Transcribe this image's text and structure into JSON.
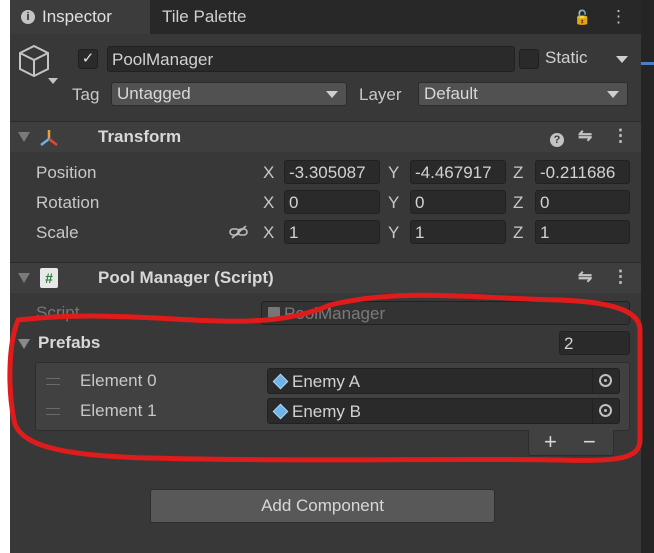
{
  "tabs": [
    {
      "label": "Inspector",
      "icon": "info-icon"
    },
    {
      "label": "Tile Palette"
    }
  ],
  "tab_icons": {
    "lock": "🔓",
    "menu": "⋮"
  },
  "object": {
    "name": "PoolManager",
    "active_checked": true,
    "static_label": "Static",
    "tag_label": "Tag",
    "tag_value": "Untagged",
    "layer_label": "Layer",
    "layer_value": "Default"
  },
  "transform": {
    "title": "Transform",
    "rows": [
      {
        "label": "Position",
        "x": "-3.305087",
        "y": "-4.467917",
        "z": "-0.211686"
      },
      {
        "label": "Rotation",
        "x": "0",
        "y": "0",
        "z": "0"
      },
      {
        "label": "Scale",
        "x": "1",
        "y": "1",
        "z": "1"
      }
    ],
    "axis": {
      "x": "X",
      "y": "Y",
      "z": "Z"
    }
  },
  "pool_manager": {
    "title": "Pool Manager (Script)",
    "script_label": "Script",
    "script_value": "PoolManager",
    "prefabs_label": "Prefabs",
    "prefabs_count": "2",
    "elements": [
      {
        "label": "Element 0",
        "value": "Enemy A"
      },
      {
        "label": "Element 1",
        "value": "Enemy B"
      }
    ],
    "add": "+",
    "remove": "−"
  },
  "add_component": "Add Component",
  "annotation_color": "#e01b1b"
}
